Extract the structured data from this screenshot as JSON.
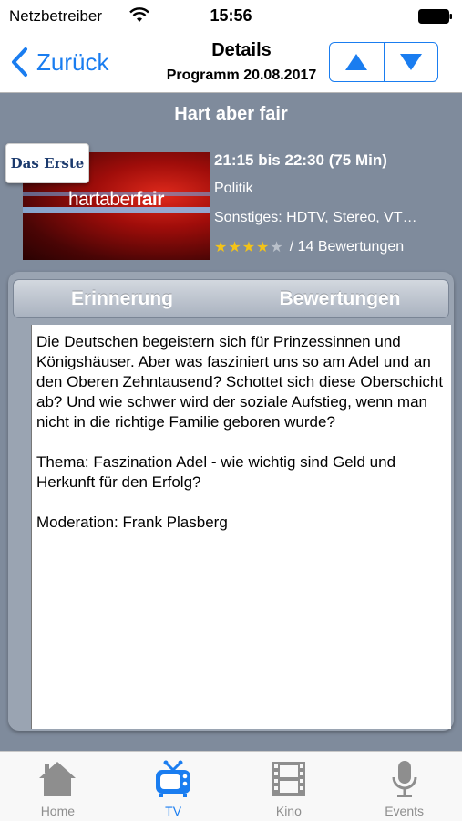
{
  "status_bar": {
    "carrier": "Netzbetreiber",
    "time": "15:56"
  },
  "nav": {
    "back_label": "Zurück",
    "title": "Details",
    "subtitle": "Programm 20.08.2017"
  },
  "show": {
    "title": "Hart aber fair",
    "channel": "Das Erste",
    "thumbnail_logo_light": "hartaber",
    "thumbnail_logo_bold": "fair",
    "time": "21:15 bis 22:30 (75 Min)",
    "genre": "Politik",
    "misc": "Sonstiges: HDTV, Stereo, VT…",
    "rating_stars": 4,
    "rating_max": 5,
    "rating_text": "/ 14 Bewertungen"
  },
  "tabs": {
    "reminder": "Erinnerung",
    "ratings": "Bewertungen"
  },
  "description": {
    "paragraph1": "Die Deutschen begeistern sich für Prinzessinnen und Königshäuser. Aber was fasziniert uns so am Adel und an den Oberen Zehntausend? Schottet sich diese Oberschicht ab? Und wie schwer wird der soziale Aufstieg, wenn man nicht in die richtige Familie geboren wurde?",
    "paragraph2": "Thema: Faszination Adel - wie wichtig sind Geld und Herkunft für den Erfolg?",
    "paragraph3": "Moderation: Frank Plasberg"
  },
  "tabbar": {
    "home": "Home",
    "tv": "TV",
    "kino": "Kino",
    "events": "Events",
    "active": "tv"
  },
  "colors": {
    "accent": "#1a7df0",
    "background": "#7f8b9c",
    "star": "#f3c318"
  }
}
